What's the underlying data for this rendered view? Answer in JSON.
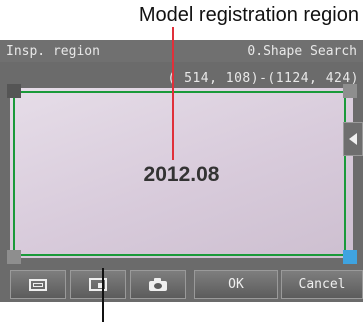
{
  "callout": {
    "label": "Model registration region"
  },
  "topbar": {
    "left_label": "Insp. region",
    "right_label": "0.Shape Search"
  },
  "region": {
    "coordinates": "( 514, 108)-(1124, 424)"
  },
  "image": {
    "text": "2012.08"
  },
  "buttons": {
    "ok_label": "OK",
    "cancel_label": "Cancel",
    "icons": [
      "frame-icon",
      "window-icon",
      "camera-icon"
    ]
  },
  "colors": {
    "region_border": "#1a9a3a",
    "leader_line": "#e0303a",
    "active_handle": "#3fa3e0"
  }
}
